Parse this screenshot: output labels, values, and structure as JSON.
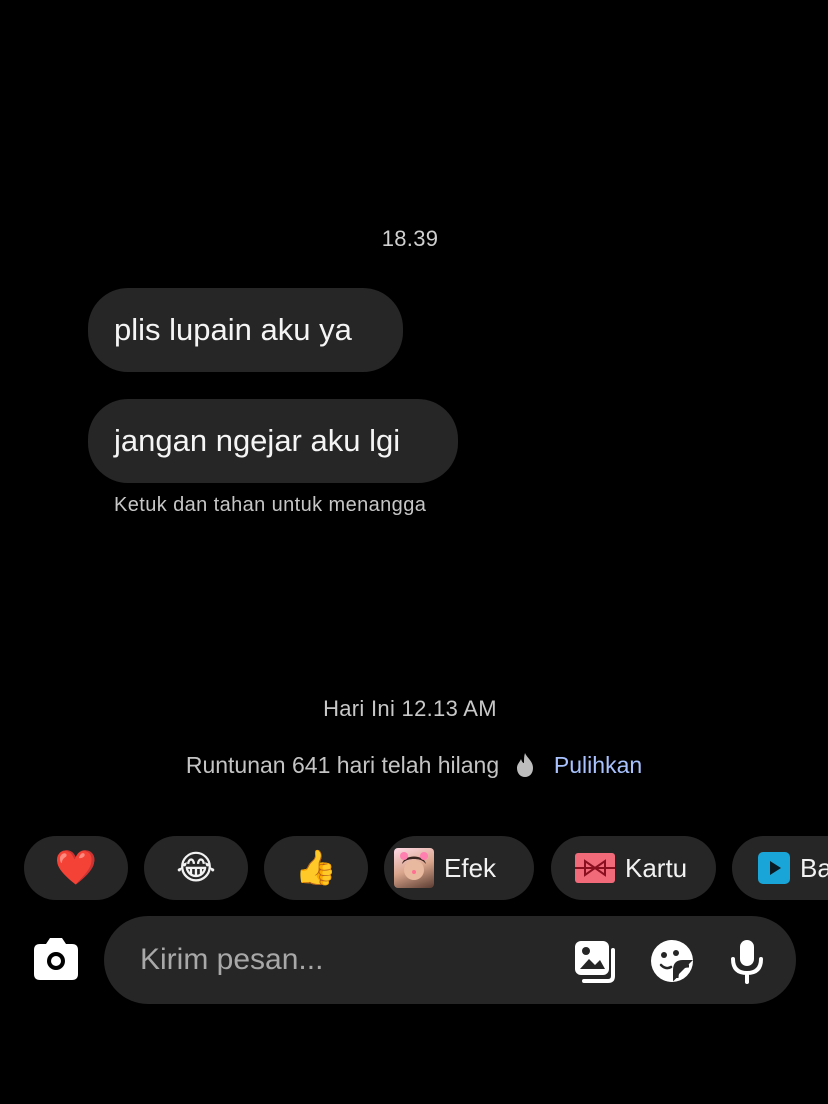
{
  "chat": {
    "timestamp_top": "18.39",
    "messages": [
      {
        "text": "plis lupain aku ya"
      },
      {
        "text": "jangan ngejar aku lgi"
      }
    ],
    "hint": "Ketuk dan tahan untuk menangga",
    "timestamp_today": "Hari Ini 12.13 AM",
    "streak_text": "Runtunan 641 hari telah hilang",
    "streak_action": "Pulihkan"
  },
  "quick_replies": {
    "items": [
      {
        "icon": "heart-emoji",
        "emoji": "❤️"
      },
      {
        "icon": "laughing-emoji",
        "emoji": "😂"
      },
      {
        "icon": "thumbs-up-emoji",
        "emoji": "👍"
      },
      {
        "icon": "effect-thumbnail-icon",
        "label": "Efek"
      },
      {
        "icon": "gift-card-icon",
        "label": "Kartu"
      },
      {
        "icon": "play-icon",
        "label": "Ba"
      }
    ]
  },
  "composer": {
    "placeholder": "Kirim pesan...",
    "icons": [
      "camera-icon",
      "gallery-icon",
      "sticker-icon",
      "microphone-icon"
    ]
  },
  "colors": {
    "background": "#000000",
    "bubble": "#262626",
    "link": "#a9c3ff"
  }
}
